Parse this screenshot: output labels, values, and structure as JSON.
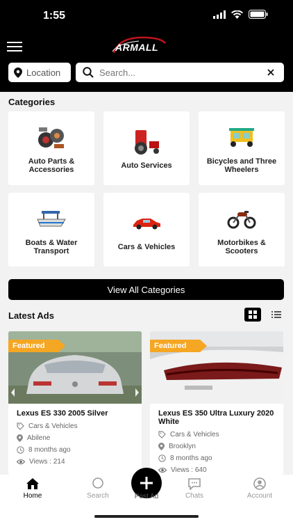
{
  "status_bar": {
    "time": "1:55"
  },
  "header": {
    "logo_text": "ARMALL"
  },
  "location": {
    "label": "Location"
  },
  "search": {
    "placeholder": "Search..."
  },
  "categories_section": {
    "title": "Categories",
    "items": [
      {
        "label": "Auto Parts & Accessories",
        "icon": "auto-parts-icon"
      },
      {
        "label": "Auto Services",
        "icon": "auto-services-icon"
      },
      {
        "label": "Bicycles and Three Wheelers",
        "icon": "tuk-tuk-icon"
      },
      {
        "label": "Boats & Water Transport",
        "icon": "boat-icon"
      },
      {
        "label": "Cars & Vehicles",
        "icon": "car-icon"
      },
      {
        "label": "Motorbikes & Scooters",
        "icon": "motorbike-icon"
      }
    ],
    "view_all_label": "View All Categories"
  },
  "latest_ads": {
    "title": "Latest Ads",
    "items": [
      {
        "badge": "Featured",
        "title": "Lexus ES 330 2005 Silver",
        "category": "Cars & Vehicles",
        "location": "Abilene",
        "time": "8 months ago",
        "views": "Views :  214"
      },
      {
        "badge": "Featured",
        "title": "Lexus ES 350 Ultra Luxury 2020 White",
        "category": "Cars & Vehicles",
        "location": "Brooklyn",
        "time": "8 months ago",
        "views": "Views :  640"
      }
    ]
  },
  "bottom_nav": {
    "home": "Home",
    "search": "Search",
    "post_ad": "Post Ad",
    "chats": "Chats",
    "account": "Account"
  },
  "colors": {
    "accent": "#f5a623",
    "primary": "#000000"
  }
}
